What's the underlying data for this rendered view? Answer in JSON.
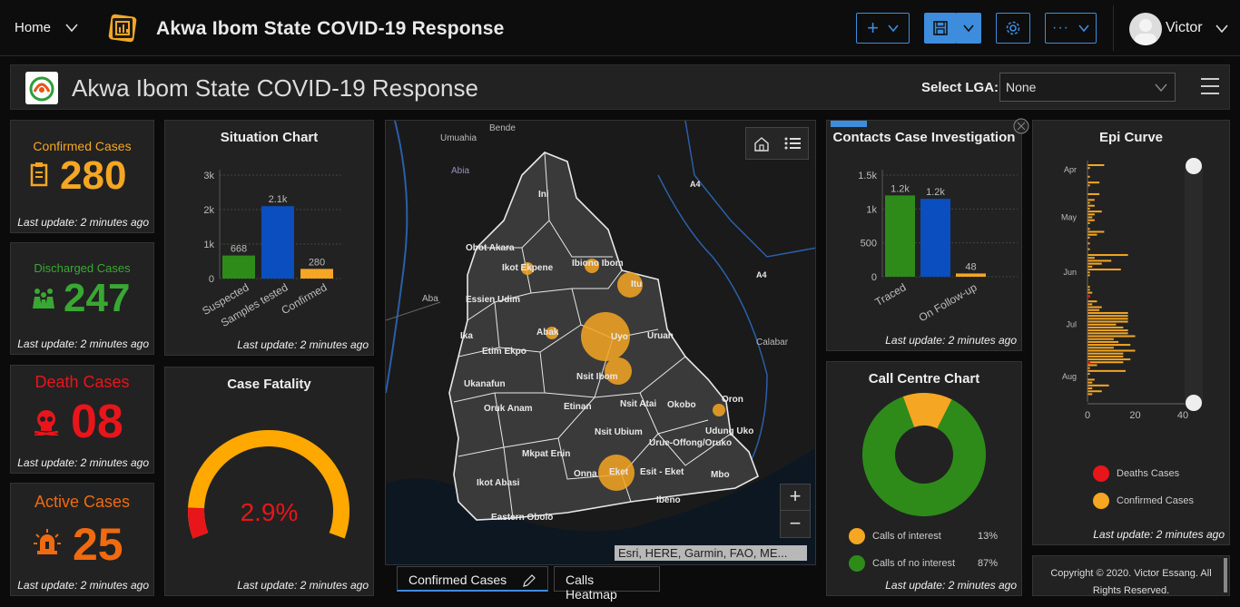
{
  "topbar": {
    "home_label": "Home",
    "title": "Akwa Ibom State COVID-19 Response",
    "user_name": "Victor",
    "accent": "#3d8ddc"
  },
  "header": {
    "title": "Akwa Ibom State COVID-19 Response",
    "lga_label": "Select LGA:",
    "lga_value": "None"
  },
  "stats": {
    "confirmed": {
      "label": "Confirmed Cases",
      "value": "280",
      "footer": "Last update: 2 minutes ago",
      "color": "#f5a623",
      "icon": "clipboard-icon"
    },
    "discharged": {
      "label": "Discharged Cases",
      "value": "247",
      "footer": "Last update: 2 minutes ago",
      "color": "#38a832",
      "icon": "people-icon"
    },
    "deaths": {
      "label": "Death Cases",
      "value": "08",
      "footer": "Last update: 2 minutes ago",
      "color": "#e8151b",
      "icon": "skull-icon"
    },
    "active": {
      "label": "Active Cases",
      "value": "25",
      "footer": "Last update: 2 minutes ago",
      "color": "#f06a0f",
      "icon": "siren-icon"
    }
  },
  "situation": {
    "title": "Situation Chart",
    "footer": "Last update: 2 minutes ago",
    "value_labels": [
      "668",
      "2.1k",
      "280"
    ],
    "tick_labels": [
      "0",
      "1k",
      "2k",
      "3k"
    ]
  },
  "fatality": {
    "title": "Case Fatality",
    "value_label": "2.9%",
    "footer": "Last update: 2 minutes ago"
  },
  "map": {
    "attribution": "Esri, HERE, Garmin, FAO, ME...",
    "labels": [
      "Bende",
      "Umuahia",
      "Abia",
      "Ini",
      "Obot Akara",
      "Ikot Ekpene",
      "Ibiono Ibom",
      "Itu",
      "Essien Udim",
      "Aba",
      "Abak",
      "Uyo",
      "Uruan",
      "Ika",
      "Etim Ekpo",
      "Nsit Ibom",
      "Calabar",
      "Ukanafun",
      "Oruk Anam",
      "Etinan",
      "Nsit Atai",
      "Okobo",
      "Oron",
      "Udung Uko",
      "Nsit Ubium",
      "Urue-Offong/Oruko",
      "Mkpat Enin",
      "Onna",
      "Eket",
      "Esit - Eket",
      "Mbo",
      "Ikot Abasi",
      "Ibeno",
      "Eastern Obolo",
      "A4",
      "A4"
    ]
  },
  "tabs": {
    "confirmed_label": "Confirmed Cases",
    "heatmap_label": "Calls Heatmap"
  },
  "contacts": {
    "title": "Contacts Case Investigation",
    "footer": "Last update: 2 minutes ago",
    "value_labels": [
      "1.2k",
      "1.2k",
      "48"
    ],
    "tick_labels": [
      "0",
      "500",
      "1k",
      "1.5k"
    ]
  },
  "callcentre": {
    "title": "Call Centre Chart",
    "footer": "Last update: 2 minutes ago",
    "legend": [
      {
        "label": "Calls of interest",
        "pct": "13%"
      },
      {
        "label": "Calls of no interest",
        "pct": "87%"
      }
    ]
  },
  "epi": {
    "title": "Epi Curve",
    "footer": "Last update: 2 minutes ago",
    "month_labels": [
      "Apr",
      "May",
      "Jun",
      "Jul",
      "Aug"
    ],
    "tick_labels": [
      "0",
      "20",
      "40"
    ],
    "legend": [
      "Deaths Cases",
      "Confirmed Cases"
    ]
  },
  "copyright": "Copyright © 2020. Victor Essang. All Rights Reserved.",
  "chart_data": [
    {
      "type": "bar",
      "title": "Situation Chart",
      "categories": [
        "Suspected",
        "Samples tested",
        "Confirmed"
      ],
      "values": [
        668,
        2100,
        280
      ],
      "colors": [
        "#2e8b1a",
        "#0a4ebf",
        "#f5a623"
      ],
      "ylim": [
        0,
        3000
      ],
      "grid": true
    },
    {
      "type": "gauge",
      "title": "Case Fatality",
      "value": 2.9,
      "max": 100
    },
    {
      "type": "bar",
      "title": "Contacts Case Investigation",
      "categories": [
        "Traced",
        "On Follow-up"
      ],
      "values": [
        1200,
        1150,
        48
      ],
      "colors": [
        "#2e8b1a",
        "#0a4ebf",
        "#f5a623"
      ],
      "ylim": [
        0,
        1500
      ],
      "grid": true
    },
    {
      "type": "pie",
      "title": "Call Centre Chart",
      "categories": [
        "Calls of interest",
        "Calls of no interest"
      ],
      "values": [
        13,
        87
      ],
      "colors": [
        "#f5a623",
        "#2e8b1a"
      ]
    },
    {
      "type": "bar",
      "title": "Epi Curve",
      "orientation": "horizontal",
      "xlim": [
        0,
        40
      ],
      "series": [
        {
          "name": "Confirmed Cases",
          "color": "#f5a623",
          "values": [
            7,
            1,
            0,
            0,
            1,
            0,
            5,
            1,
            0,
            0,
            5,
            0,
            3,
            1,
            3,
            1,
            6,
            3,
            2,
            3,
            1,
            0,
            1,
            7,
            4,
            1,
            0,
            1,
            0,
            1,
            0,
            17,
            3,
            10,
            6,
            2,
            14,
            1,
            1,
            0,
            0,
            0,
            1,
            1,
            2,
            0,
            0,
            4,
            2,
            6,
            5,
            17,
            17,
            17,
            17,
            12,
            15,
            17,
            17,
            20,
            11,
            13,
            18,
            11,
            20,
            15,
            15,
            18,
            15,
            4,
            1,
            16,
            1,
            0,
            3,
            2,
            9,
            2,
            6,
            2,
            0,
            0
          ]
        },
        {
          "name": "Deaths Cases",
          "color": "#e8151b",
          "values_note": "marks near zero"
        }
      ],
      "y_categories": [
        "Apr",
        "May",
        "Jun",
        "Jul",
        "Aug"
      ]
    }
  ]
}
